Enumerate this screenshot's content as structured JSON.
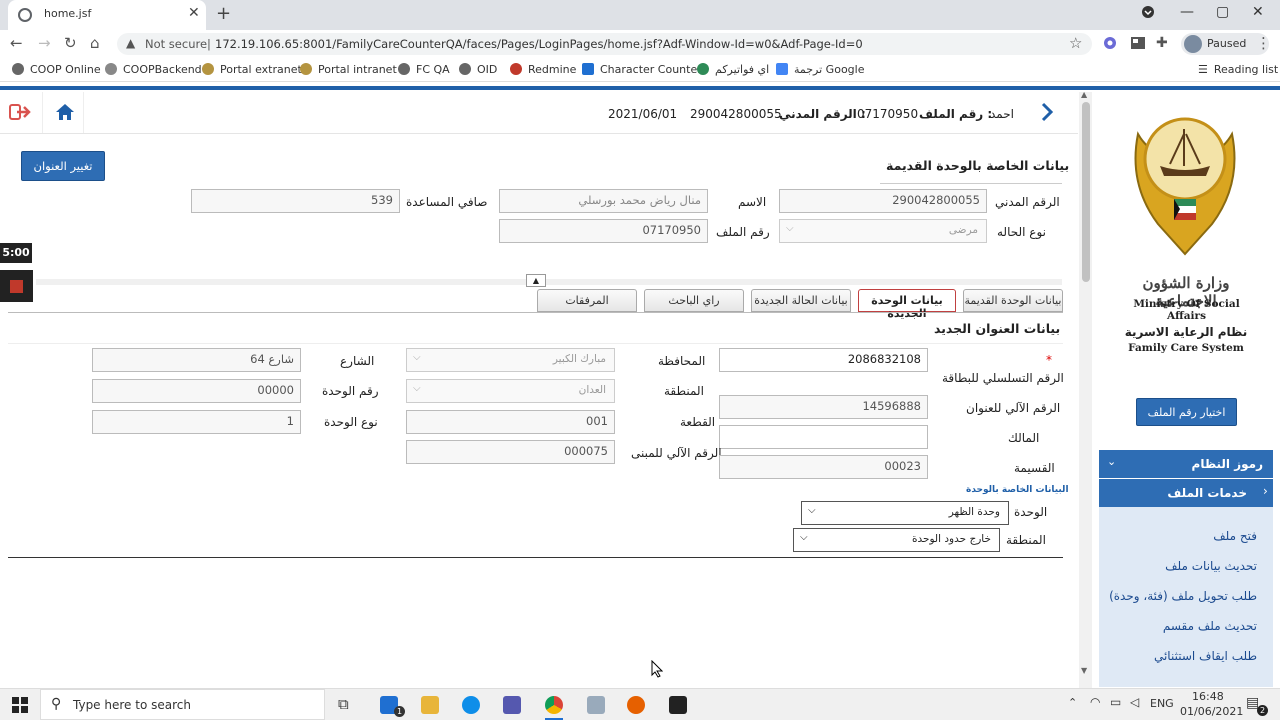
{
  "browser": {
    "tab_title": "home.jsf",
    "not_secure": "Not secure",
    "url": "172.19.106.65:8001/FamilyCareCounterQA/faces/Pages/LoginPages/home.jsf?Adf-Window-Id=w0&Adf-Page-Id=0",
    "profile": "Paused",
    "bookmarks": [
      "COOP Online",
      "COOPBackend",
      "Portal extranet",
      "Portal intranet",
      "FC QA",
      "OID",
      "Redmine",
      "Character Counter",
      "اي فواتيركم",
      "ترجمة Google"
    ],
    "reading_list": "Reading list"
  },
  "header": {
    "name": "احمد",
    "file_label": "رقم الملف :",
    "file_no": "07170950",
    "civil_label": "الرقم المدني :",
    "civil_no": "290042800055",
    "date": "2021/06/01"
  },
  "old_unit": {
    "title": "بيانات الخاصة بالوحدة القديمة",
    "change_address_button": "تغيير العنوان",
    "civil_label": "الرقم المدني",
    "civil_value": "290042800055",
    "name_label": "الاسم",
    "name_value": "منال رياض محمد بورسلي",
    "net_aid_label": "صافي المساعدة",
    "net_aid_value": "539",
    "case_type_label": "نوع الحاله",
    "case_type_value": "مرضى",
    "file_label": "رقم الملف",
    "file_value": "07170950"
  },
  "timer": "5:00",
  "tabs": [
    "بيانات الوحدة القديمة",
    "بيانات الوحدة الجديدة",
    "بيانات الحالة الجديدة",
    "راي الباحث",
    "المرفقات"
  ],
  "new_address": {
    "title": "بيانات العنوان الجديد",
    "required_mark": "*",
    "card_serial_label": "الرقم التسلسلي للبطاقة",
    "card_serial_value": "2086832108",
    "auto_addr_label": "الرقم الآلي للعنوان",
    "auto_addr_value": "14596888",
    "owner_label": "المالك",
    "owner_value": "",
    "qaseema_label": "القسيمة",
    "qaseema_value": "00023",
    "governorate_label": "المحافظة",
    "governorate_value": "مبارك الكبير",
    "area_label": "المنطقة",
    "area_value": "العدان",
    "block_label": "القطعة",
    "block_value": "001",
    "building_no_label": "الرقم الآلي للمبنى",
    "building_no_value": "000075",
    "street_label": "الشارع",
    "street_value": "شارع 64",
    "unit_no_label": "رقم الوحدة",
    "unit_no_value": "00000",
    "unit_type_label": "نوع الوحدة",
    "unit_type_value": "1",
    "unit_section_title": "البيانات الخاصة بالوحدة",
    "unit_label": "الوحدة",
    "unit_value": "وحدة الظهر",
    "region_label": "المنطقة",
    "region_value": "خارج حدود الوحدة"
  },
  "sidebar": {
    "ministry_ar": "وزارة الشؤون الاجتماعية",
    "ministry_en": "Ministry Of Social Affairs",
    "system_ar": "نظام الرعاية الاسرية",
    "system_en": "Family Care System",
    "choose_file_button": "اختيار رقم الملف",
    "system_codes": "رموز النظام",
    "file_services": "خدمات الملف",
    "items": [
      "فتح ملف",
      "تحديث بيانات ملف",
      "طلب تحويل ملف (فئة، وحدة)",
      "تحديث ملف مقسم",
      "طلب ايقاف استثنائي"
    ]
  },
  "taskbar": {
    "search_placeholder": "Type here to search",
    "lang": "ENG",
    "time": "16:48",
    "date": "01/06/2021",
    "mail_badge": "1",
    "notif_badge": "2"
  }
}
